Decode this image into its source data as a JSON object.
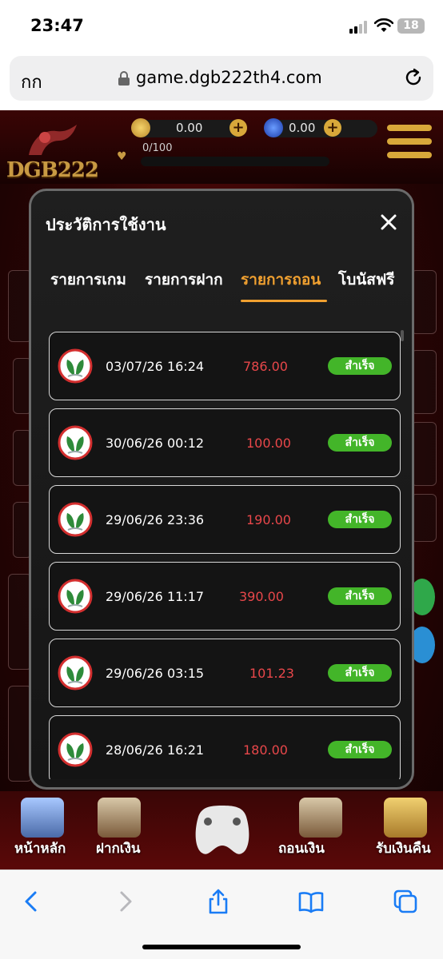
{
  "status_bar": {
    "time": "23:47",
    "battery": "18"
  },
  "browser": {
    "aa_label": "กก",
    "url": "game.dgb222th4.com"
  },
  "game_header": {
    "logo": "DGB222",
    "coin_balance": "0.00",
    "gem_balance": "0.00",
    "progress_text": "0/100",
    "progress_fraction": 0
  },
  "modal": {
    "title": "ประวัติการใช้งาน",
    "tabs": [
      {
        "label": "รายการเกม"
      },
      {
        "label": "รายการฝาก"
      },
      {
        "label": "รายการถอน"
      },
      {
        "label": "โบนัสฟรี"
      }
    ],
    "active_tab": "รายการถอน",
    "rows": [
      {
        "date": "03/07/26 16:24",
        "amount": "786.00",
        "status": "สำเร็จ"
      },
      {
        "date": "30/06/26 00:12",
        "amount": "100.00",
        "status": "สำเร็จ"
      },
      {
        "date": "29/06/26 23:36",
        "amount": "190.00",
        "status": "สำเร็จ"
      },
      {
        "date": "29/06/26 11:17",
        "amount": "390.00",
        "status": "สำเร็จ"
      },
      {
        "date": "29/06/26 03:15",
        "amount": "101.23",
        "status": "สำเร็จ"
      },
      {
        "date": "28/06/26 16:21",
        "amount": "180.00",
        "status": "สำเร็จ"
      }
    ]
  },
  "bottom_nav": [
    {
      "label": "หน้าหลัก"
    },
    {
      "label": "ฝากเงิน"
    },
    {
      "label": "ถอนเงิน"
    },
    {
      "label": "รับเงินคืน"
    }
  ],
  "colors": {
    "accent": "#f0a030",
    "amount": "#e8474a",
    "success": "#43b529",
    "bank_green": "#2e8b3a",
    "bank_red": "#d32f2f"
  }
}
